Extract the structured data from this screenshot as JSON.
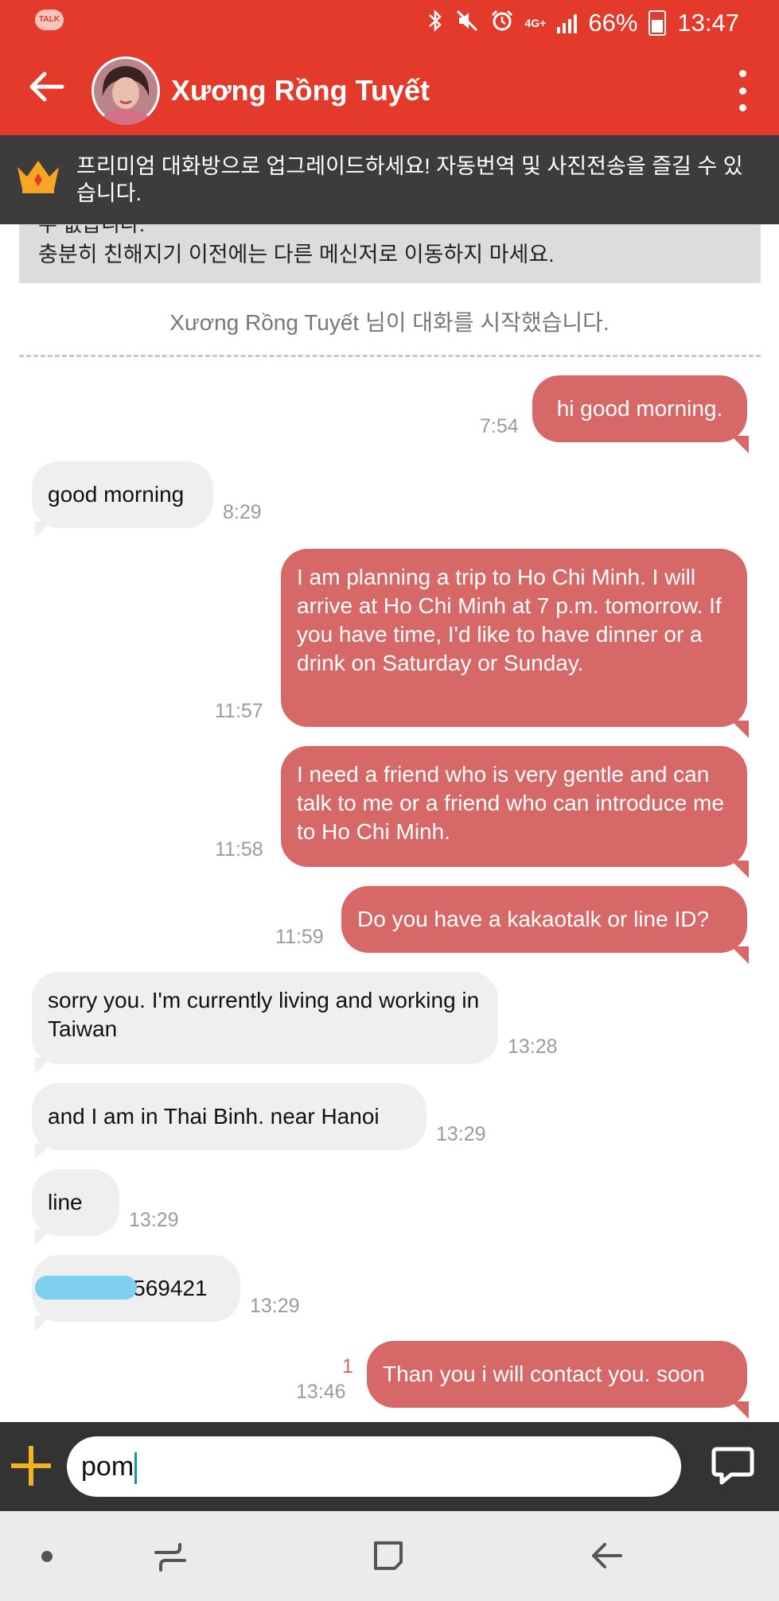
{
  "status_bar": {
    "app_badge": "TALK",
    "network": "4G+",
    "battery": "66%",
    "time": "13:47"
  },
  "header": {
    "contact_name": "Xương Rồng Tuyết"
  },
  "premium_banner": {
    "text": "프리미엄 대화방으로 업그레이드하세요! 자동번역 및 사진전송을 즐길 수 있습니다."
  },
  "notice": {
    "line1": "수 없습니다.",
    "line2": "충분히 친해지기 이전에는 다른 메신저로 이동하지 마세요."
  },
  "system_message": "Xương Rồng Tuyết 님이 대화를 시작했습니다.",
  "messages": [
    {
      "dir": "out",
      "text": "hi good morning.",
      "time": "7:54"
    },
    {
      "dir": "in",
      "text": "good morning",
      "time": "8:29"
    },
    {
      "dir": "out",
      "text": "I am planning a trip to Ho Chi Minh. I will arrive at Ho Chi Minh at 7 p.m. tomorrow. If you have time, I'd like to have dinner or a drink on Saturday or Sunday.",
      "time": "11:57"
    },
    {
      "dir": "out",
      "text": "I need a friend who is very gentle and can talk to me or a friend who can introduce me to Ho Chi Minh.",
      "time": "11:58"
    },
    {
      "dir": "out",
      "text": "Do you have a kakaotalk or line ID?",
      "time": "11:59"
    },
    {
      "dir": "in",
      "text": "sorry you.  I'm currently living and working in Taiwan",
      "time": "13:28"
    },
    {
      "dir": "in",
      "text": "and I am in Thai Binh.  near Hanoi",
      "time": "13:29"
    },
    {
      "dir": "in",
      "text": "line",
      "time": "13:29"
    },
    {
      "dir": "in",
      "text": "33569421",
      "time": "13:29",
      "redacted": true
    },
    {
      "dir": "out",
      "text": "Than you i will contact you. soon",
      "time": "13:46",
      "unread": "1"
    }
  ],
  "input": {
    "value": "pom"
  },
  "colors": {
    "header": "#e43a2c",
    "outgoing_bubble": "#d66867",
    "incoming_bubble": "#efefef",
    "banner": "#3c3c3c",
    "add_button": "#f0b323"
  },
  "icons": {
    "status": [
      "bluetooth-icon",
      "mute-icon",
      "alarm-icon",
      "signal-icon",
      "battery-icon"
    ],
    "header": [
      "back-arrow-icon",
      "more-vert-icon"
    ],
    "banner": "crown-icon",
    "input": [
      "plus-icon",
      "chat-bubble-icon"
    ],
    "nav": [
      "home-dot-icon",
      "recent-apps-icon",
      "overview-icon",
      "back-icon"
    ]
  }
}
